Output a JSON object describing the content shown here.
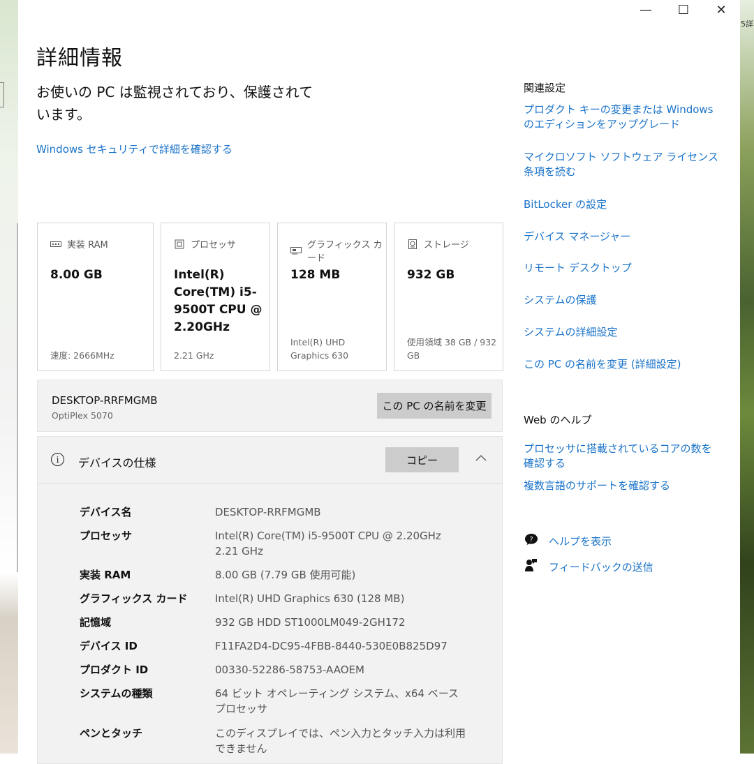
{
  "window": {
    "minimize": "—",
    "maximize": "☐",
    "close": "✕",
    "edge_text": "5詳"
  },
  "page": {
    "title": "詳細情報",
    "protection_status": "お使いの PC は監視されており、保護されています。",
    "security_link": "Windows セキュリティで詳細を確認する"
  },
  "cards": [
    {
      "icon": "memory-icon",
      "label": "実装 RAM",
      "value": "8.00 GB",
      "sub": "速度: 2666MHz"
    },
    {
      "icon": "processor-icon",
      "label": "プロセッサ",
      "value": "Intel(R) Core(TM) i5-9500T CPU @ 2.20GHz",
      "sub": "2.21 GHz"
    },
    {
      "icon": "graphics-card-icon",
      "label": "グラフィックス カード",
      "value": "128 MB",
      "sub": "Intel(R) UHD Graphics 630"
    },
    {
      "icon": "storage-icon",
      "label": "ストレージ",
      "value": "932 GB",
      "sub": "使用領域 38 GB / 932 GB"
    }
  ],
  "pc": {
    "name": "DESKTOP-RRFMGMB",
    "model": "OptiPlex 5070",
    "rename_button": "この PC の名前を変更"
  },
  "specs": {
    "title": "デバイスの仕様",
    "copy_button": "コピー",
    "collapse_icon": "chevron-up-icon",
    "rows": [
      {
        "label": "デバイス名",
        "value": "DESKTOP-RRFMGMB"
      },
      {
        "label": "プロセッサ",
        "value": "Intel(R) Core(TM) i5-9500T CPU @ 2.20GHz 2.21 GHz"
      },
      {
        "label": "実装 RAM",
        "value": "8.00 GB (7.79 GB 使用可能)"
      },
      {
        "label": "グラフィックス カード",
        "value": "Intel(R) UHD Graphics 630 (128 MB)"
      },
      {
        "label": "記憶域",
        "value": "932 GB HDD ST1000LM049-2GH172"
      },
      {
        "label": "デバイス ID",
        "value": "F11FA2D4-DC95-4FBB-8440-530E0B825D97"
      },
      {
        "label": "プロダクト ID",
        "value": "00330-52286-58753-AAOEM"
      },
      {
        "label": "システムの種類",
        "value": "64 ビット オペレーティング システム、x64 ベース プロセッサ"
      },
      {
        "label": "ペンとタッチ",
        "value": "このディスプレイでは、ペン入力とタッチ入力は利用できません"
      }
    ]
  },
  "related": {
    "heading": "関連設定",
    "links": [
      "プロダクト キーの変更または Windows のエディションをアップグレード",
      "マイクロソフト ソフトウェア ライセンス条項を読む",
      "BitLocker の設定",
      "デバイス マネージャー",
      "リモート デスクトップ",
      "システムの保護",
      "システムの詳細設定",
      "この PC の名前を変更 (詳細設定)"
    ]
  },
  "web_help": {
    "heading": "Web のヘルプ",
    "links": [
      "プロセッサに搭載されているコアの数を確認する",
      "複数言語のサポートを確認する"
    ]
  },
  "support": {
    "help_label": "ヘルプを表示",
    "help_icon": "help-chat-icon",
    "feedback_label": "フィードバックの送信",
    "feedback_icon": "feedback-icon"
  },
  "colors": {
    "link": "#1a73c9",
    "button": "#cccccc",
    "panel": "#f2f2f2"
  }
}
